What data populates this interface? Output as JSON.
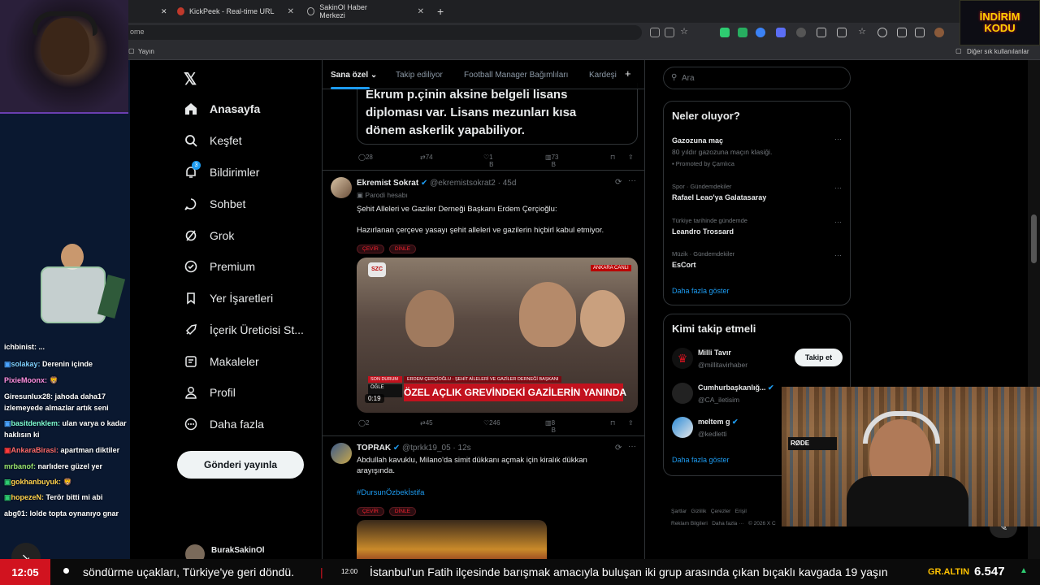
{
  "browser": {
    "tabs": [
      {
        "label": "KickPeek - Real-time URL Crawler"
      },
      {
        "label": "SakinOl Haber Merkezi"
      }
    ],
    "url_text": "ome",
    "bookmarks_left": "Yayın",
    "bookmarks_right": "Diğer sık kullanılanlar"
  },
  "nav": {
    "items": [
      {
        "label": "Anasayfa",
        "icon": "home-icon"
      },
      {
        "label": "Keşfet",
        "icon": "search-icon"
      },
      {
        "label": "Bildirimler",
        "icon": "bell-icon",
        "badge": "3"
      },
      {
        "label": "Sohbet",
        "icon": "chat-icon"
      },
      {
        "label": "Grok",
        "icon": "grok-icon"
      },
      {
        "label": "Premium",
        "icon": "premium-icon"
      },
      {
        "label": "Yer İşaretleri",
        "icon": "bookmark-icon"
      },
      {
        "label": "İçerik Üreticisi St...",
        "icon": "rocket-icon"
      },
      {
        "label": "Makaleler",
        "icon": "article-icon"
      },
      {
        "label": "Profil",
        "icon": "profile-icon"
      },
      {
        "label": "Daha fazla",
        "icon": "more-icon"
      }
    ],
    "post_button": "Gönderi yayınla",
    "account_name": "BurakSakinOl"
  },
  "feed": {
    "tabs": [
      "Sana özel",
      "Takip ediliyor",
      "Football Manager Bağımlıları",
      "Kardeşi"
    ],
    "tweet0": {
      "text_lines": [
        "Ekrum p.çinin aksine belgeli lisans",
        "diploması var. Lisans mezunları kısa",
        "dönem askerlik yapabiliyor."
      ],
      "replies": "28",
      "retweets": "74",
      "likes": "1 B",
      "views": "73 B"
    },
    "tweet1": {
      "name": "Ekremist Sokrat",
      "handle": "@ekremistsokrat2 · 45d",
      "sublabel": "Parodi hesabı",
      "line1": "Şehit Alleleri ve Gaziler Derneği Başkanı Erdem Çerçioğlu:",
      "line2": "Hazırlanan çerçeve yasayı şehit alleleri ve gazilerin hiçbirl kabul etmiyor.",
      "tag1": "ÇEVİR",
      "tag2": "DİNLE",
      "media_banner": "ÖZEL AÇLIK GREVİNDEKİ GAZİLERİN YANINDA",
      "media_caption": "ERDEM ÇERÇİOĞLU - ŞEHİT AİLELERİ VE GAZİLER DERNEĞİ BAŞKANI",
      "media_left_label": "SON DURUM",
      "media_left_label2": "ÖĞLE",
      "media_time": "0:19",
      "media_channel": "SZC",
      "media_live": "ANKARA CANLI",
      "replies": "2",
      "retweets": "45",
      "likes": "246",
      "views": "8 B"
    },
    "tweet2": {
      "name": "TOPRAK",
      "handle": "@tprkk19_05 · 12s",
      "line1": "Abdullah kavuklu, Milano'da simit dükkanı açmak için kiralık dükkan",
      "line2": "arayışında.",
      "hashtag": "#DursunÖzbekİstifa",
      "tag1": "ÇEVİR",
      "tag2": "DİNLE"
    }
  },
  "sidebar": {
    "search_placeholder": "Ara",
    "trends_title": "Neler oluyor?",
    "promo": {
      "name": "Gazozuna maç",
      "desc": "80 yıldır gazozuna maçın klasiği.",
      "promoted": "Promoted by Çamlıca"
    },
    "trends": [
      {
        "category": "Spor · Gündemdekiler",
        "name": "Rafael Leao'ya Galatasaray"
      },
      {
        "category": "Türkiye tarihinde gündemde",
        "name": "Leandro Trossard"
      },
      {
        "category": "Müzik · Gündemdekiler",
        "name": "EsCort"
      }
    ],
    "show_more": "Daha fazla göster",
    "who_title": "Kimi takip etmeli",
    "who": [
      {
        "name": "Milli Tavır",
        "handle": "@millitavirhaber"
      },
      {
        "name": "Cumhurbaşkanlığ...",
        "handle": "@CA_iletisim"
      },
      {
        "name": "meltem g",
        "handle": "@kedletti"
      }
    ],
    "follow_label": "Takip et",
    "who_more": "Daha fazla göster",
    "footer1": "Şartlar   Gizlilik   Çerezler   Erişil",
    "footer2": "Reklam Bilgileri   Daha fazla ···   © 2026 X C"
  },
  "chat": [
    {
      "user": "ichbinist:",
      "msg": " ...",
      "color": "#ffffff"
    },
    {
      "user": "solakay:",
      "msg": " Derenin içinde",
      "color": "#7fd1ff"
    },
    {
      "user": "PixieMoonx:",
      "msg": " 🦁",
      "color": "#ff8fe1"
    },
    {
      "user": "Giresunlux28:",
      "msg": " jahoda daha17 izlemeyede almazlar artık seni",
      "color": "#ffffff"
    },
    {
      "user": "basitdenklem:",
      "msg": " ulan varya o kadar haklısın ki",
      "color": "#7fffd4"
    },
    {
      "user": "AnkaraBirasi:",
      "msg": " apartman diktiler",
      "color": "#ff6b6b"
    },
    {
      "user": "mrbanof:",
      "msg": " narlıdere güzel yer",
      "color": "#9ae66e"
    },
    {
      "user": "gokhanbuyuk:",
      "msg": " 🦁",
      "color": "#ffd24d"
    },
    {
      "user": "hopezeN:",
      "msg": " Terör bitti mi abi",
      "color": "#ffd24d"
    },
    {
      "user": "abg01:",
      "msg": " lolde topta oynanıyo gnar",
      "color": "#ffffff"
    }
  ],
  "ticker": {
    "time": "12:05",
    "text1": "söndürme uçakları, Türkiye'ye geri döndü.",
    "stamp": "12:00",
    "text2": "İstanbul'un Fatih ilçesinde barışmak amacıyla buluşan iki grup arasında çıkan bıçaklı kavgada 19 yaşın",
    "gold_label": "GR.ALTIN",
    "gold_value": "6.547"
  },
  "overlay_logo": {
    "line1": "İNDİRİM",
    "line2": "KODU"
  },
  "colors": {
    "accent": "#1d9bf0",
    "ticker_red": "#d1131f",
    "tag_red": "#f4212e"
  }
}
